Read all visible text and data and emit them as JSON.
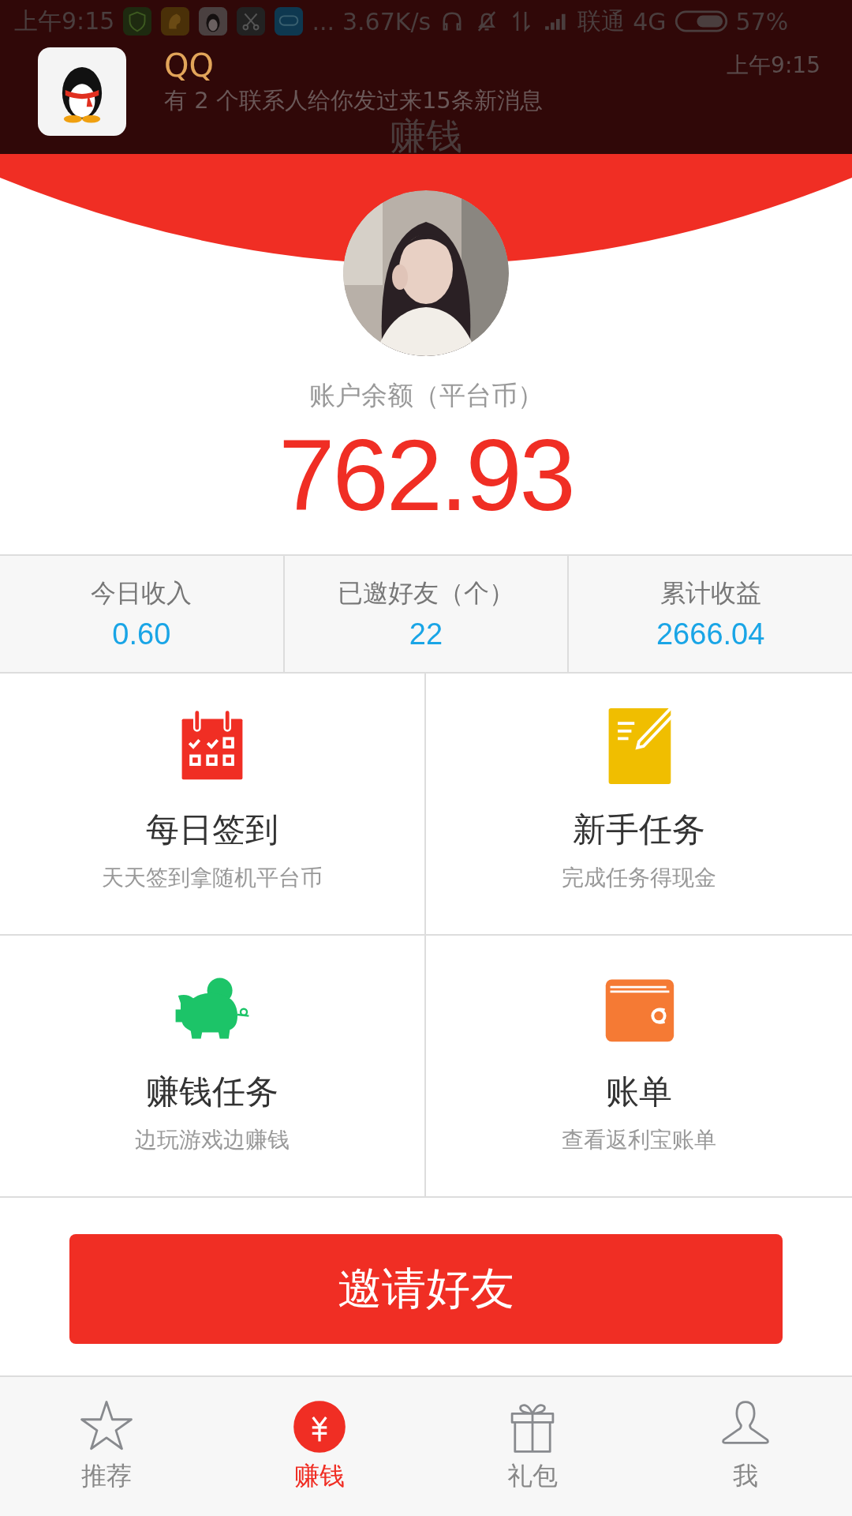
{
  "status_bar": {
    "time": "上午9:15",
    "more": "...",
    "speed": "3.67K/s",
    "carrier": "联通",
    "network": "4G",
    "battery_text": "57%"
  },
  "notification": {
    "app": "QQ",
    "time": "上午9:15",
    "message": "有 2 个联系人给你发过来15条新消息"
  },
  "header": {
    "title": "赚钱"
  },
  "balance": {
    "label": "账户余额（平台币）",
    "amount": "762.93"
  },
  "stats": [
    {
      "label": "今日收入",
      "value": "0.60"
    },
    {
      "label": "已邀好友（个）",
      "value": "22"
    },
    {
      "label": "累计收益",
      "value": "2666.04"
    }
  ],
  "features": [
    {
      "kind": "calendar",
      "title": "每日签到",
      "subtitle": "天天签到拿随机平台币"
    },
    {
      "kind": "note",
      "title": "新手任务",
      "subtitle": "完成任务得现金"
    },
    {
      "kind": "piggy",
      "title": "赚钱任务",
      "subtitle": "边玩游戏边赚钱"
    },
    {
      "kind": "wallet",
      "title": "账单",
      "subtitle": "查看返利宝账单"
    }
  ],
  "invite_button": "邀请好友",
  "tabs": [
    {
      "kind": "star",
      "label": "推荐",
      "selected": false
    },
    {
      "kind": "yen",
      "label": "赚钱",
      "selected": true
    },
    {
      "kind": "gift",
      "label": "礼包",
      "selected": false
    },
    {
      "kind": "person",
      "label": "我",
      "selected": false
    }
  ]
}
